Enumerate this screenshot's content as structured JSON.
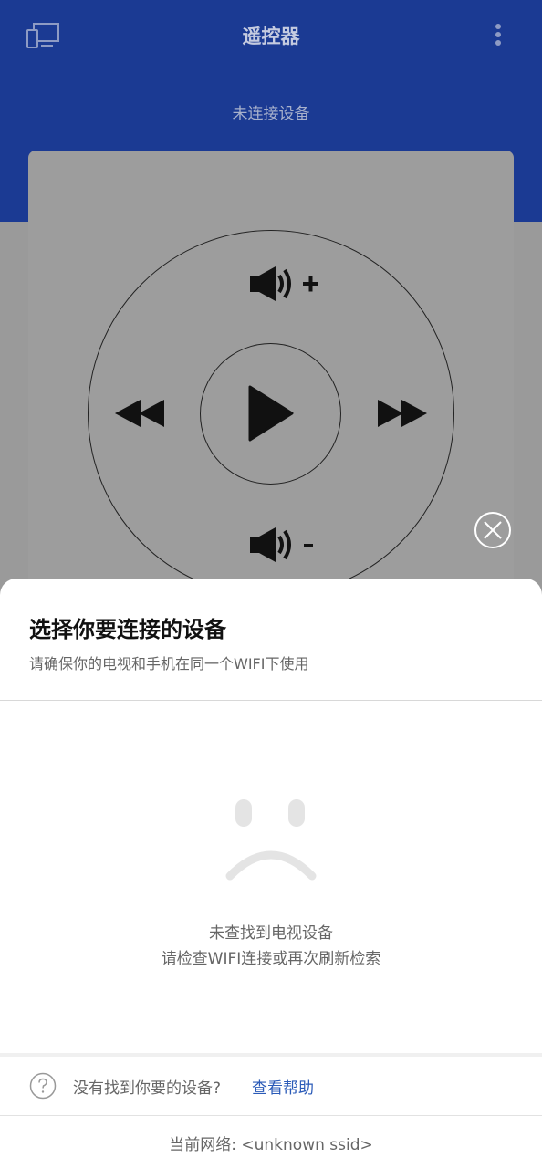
{
  "header": {
    "title": "遥控器",
    "left_icon": "devices-icon",
    "right_icon": "more-vertical-icon"
  },
  "connection": {
    "status": "未连接设备"
  },
  "remote": {
    "volume_up_icon": "volume-up-icon",
    "volume_down_icon": "volume-down-icon",
    "rewind_icon": "rewind-icon",
    "play_icon": "play-icon",
    "fast_forward_icon": "fast-forward-icon",
    "close_icon": "close-icon"
  },
  "sheet": {
    "title": "选择你要连接的设备",
    "subtitle": "请确保你的电视和手机在同一个WIFI下使用",
    "empty_icon": "sad-face-icon",
    "empty_line1": "未查找到电视设备",
    "empty_line2": "请检查WIFI连接或再次刷新检索",
    "help_text": "没有找到你要的设备?",
    "help_link": "查看帮助",
    "network": "当前网络: <unknown ssid>"
  },
  "colors": {
    "header_bg": "#1b3a93",
    "link": "#2b5bb8",
    "overlay": "#9a9a9a"
  }
}
